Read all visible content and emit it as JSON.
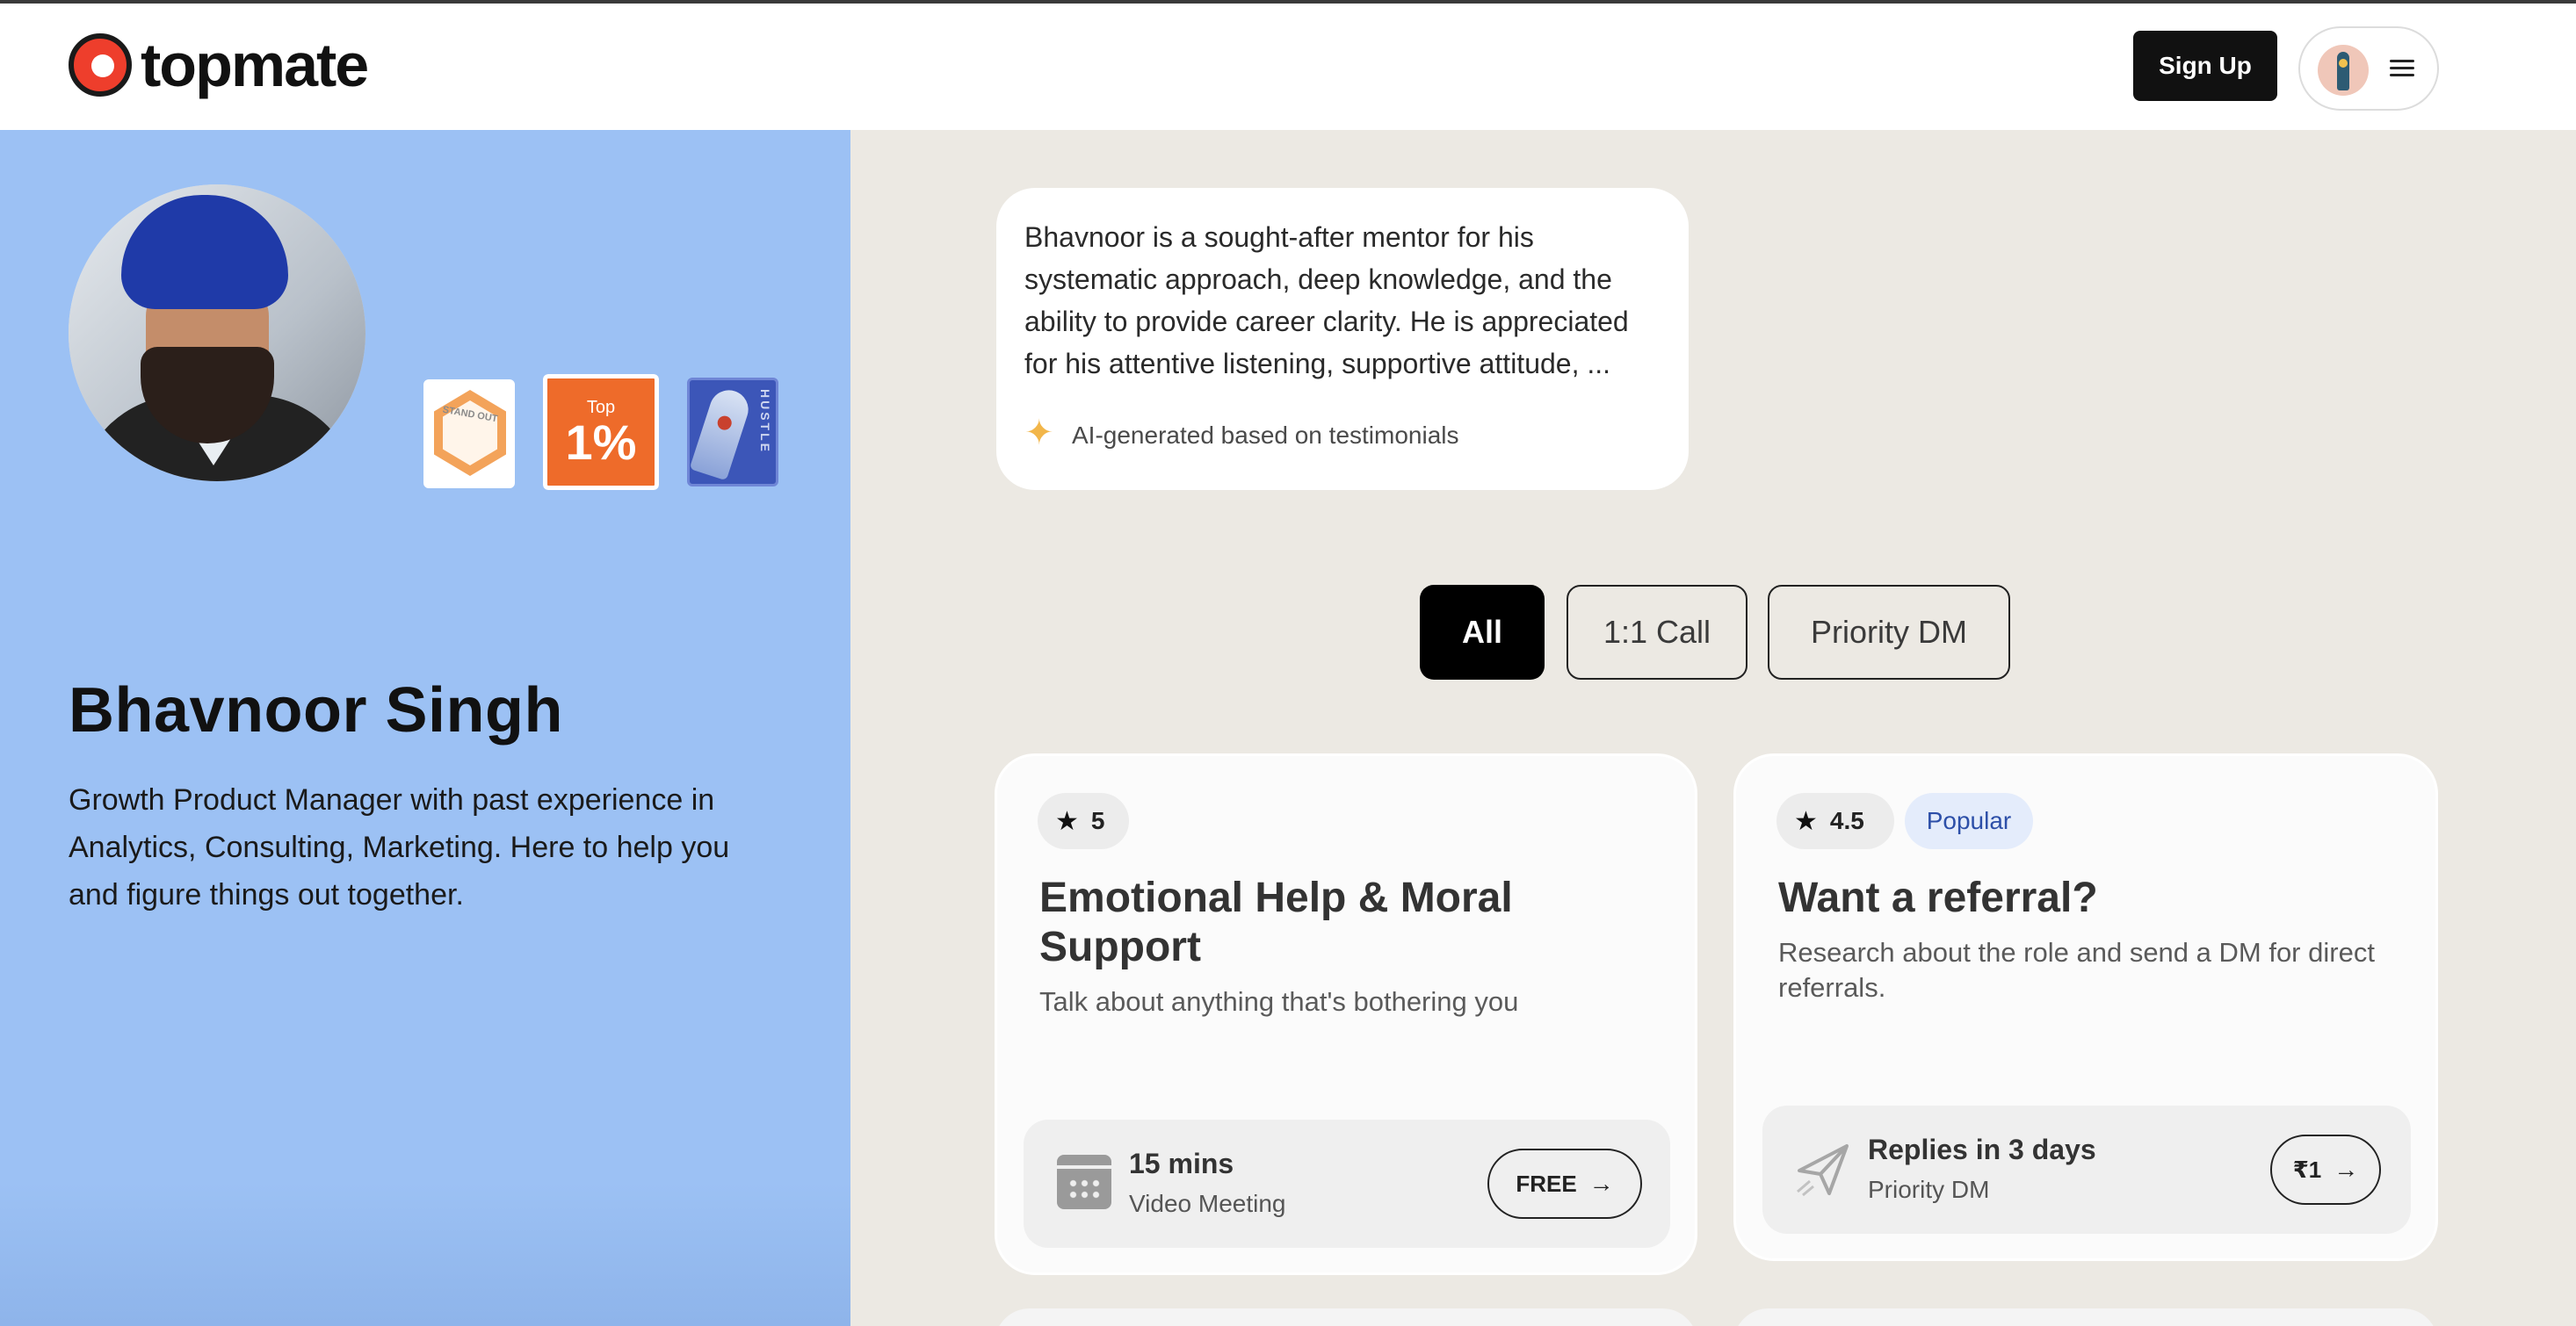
{
  "header": {
    "logo_text": "topmate",
    "signup_label": "Sign Up"
  },
  "profile": {
    "name": "Bhavnoor Singh",
    "bio": "Growth Product Manager with past experience in Analytics, Consulting, Marketing. Here to help you and figure things out together.",
    "badges": {
      "standout_text": "STAND OUT",
      "top_small": "Top",
      "top_big": "1%",
      "hustle_text": "HUSTLE"
    }
  },
  "summary": {
    "text": "Bhavnoor is a sought-after mentor for his systematic approach, deep knowledge, and the ability to provide career clarity. He is appreciated for his attentive listening, supportive attitude, ...",
    "footnote": "AI-generated based on testimonials"
  },
  "tabs": [
    {
      "label": "All",
      "active": true
    },
    {
      "label": "1:1 Call",
      "active": false
    },
    {
      "label": "Priority DM",
      "active": false
    }
  ],
  "services": [
    {
      "rating": "5",
      "title": "Emotional Help & Moral Support",
      "description": "Talk about anything that's bothering you",
      "footer_title": "15 mins",
      "footer_sub": "Video Meeting",
      "price": "FREE",
      "icon": "calendar-icon"
    },
    {
      "rating": "4.5",
      "badge": "Popular",
      "title": "Want a referral?",
      "description": "Research about the role and send a DM for direct referrals.",
      "footer_title": "Replies in 3 days",
      "footer_sub": "Priority DM",
      "price": "₹1",
      "icon": "paper-plane-icon"
    }
  ],
  "colors": {
    "left_panel": "#9cc1f4",
    "page_bg": "#ece9e3",
    "logo_red": "#ee3e2c",
    "top_badge": "#ee6b2a",
    "popular_text": "#2d4fa8"
  }
}
